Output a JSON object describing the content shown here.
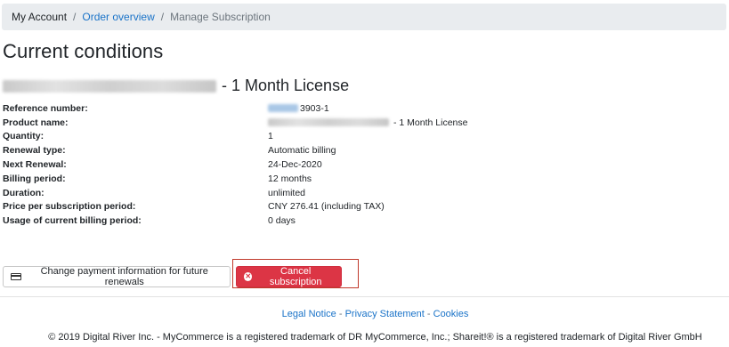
{
  "breadcrumb": {
    "my_account": "My Account",
    "separator": "/",
    "order_overview": "Order overview",
    "current": "Manage Subscription"
  },
  "page_title": "Current conditions",
  "license": {
    "title_suffix": "- 1 Month License"
  },
  "details": [
    {
      "label": "Reference number:",
      "value": "3903-1"
    },
    {
      "label": "Product name:",
      "value": "- 1 Month License"
    },
    {
      "label": "Quantity:",
      "value": "1"
    },
    {
      "label": "Renewal type:",
      "value": "Automatic billing"
    },
    {
      "label": "Next Renewal:",
      "value": "24-Dec-2020"
    },
    {
      "label": "Billing period:",
      "value": "12 months"
    },
    {
      "label": "Duration:",
      "value": "unlimited"
    },
    {
      "label": "Price per subscription period:",
      "value": "CNY 276.41 (including TAX)"
    },
    {
      "label": "Usage of current billing period:",
      "value": "0 days"
    }
  ],
  "buttons": {
    "change_payment": "Change payment information for future renewals",
    "cancel_subscription": "Cancel subscription"
  },
  "footer": {
    "legal_notice": "Legal Notice",
    "separator": "-",
    "privacy_statement": "Privacy Statement",
    "cookies": "Cookies",
    "copyright": "© 2019 Digital River Inc. - MyCommerce is a registered trademark of DR MyCommerce, Inc.; Shareit!® is a registered trademark of Digital River GmbH"
  },
  "colors": {
    "link": "#1a73c8",
    "danger": "#dc3545",
    "breadcrumb_bg": "#e9ecef",
    "highlight": "#c0392b"
  }
}
